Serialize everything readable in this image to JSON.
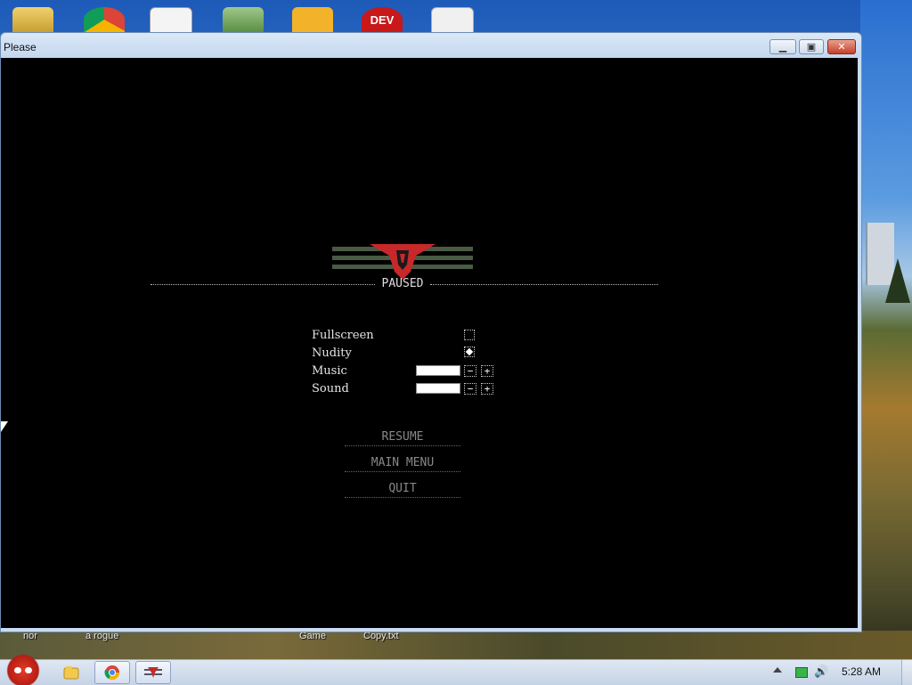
{
  "window": {
    "title": "Please",
    "minimize_icon": "minimize-icon",
    "maximize_icon": "maximize-icon",
    "close_icon": "close-icon"
  },
  "game": {
    "header": "PAUSED",
    "options": [
      {
        "label": "Fullscreen",
        "control": "checkbox",
        "checked": false
      },
      {
        "label": "Nudity",
        "control": "checkbox",
        "checked": true
      },
      {
        "label": "Music",
        "control": "slider",
        "value": 1.0
      },
      {
        "label": "Sound",
        "control": "slider",
        "value": 1.0
      }
    ],
    "stepper_minus": "−",
    "stepper_plus": "+",
    "menu": {
      "resume": "RESUME",
      "main_menu": "MAIN MENU",
      "quit": "QUIT"
    },
    "colors": {
      "emblem_red": "#c8282a",
      "emblem_stripes": "#4a5a44",
      "background": "#000000"
    }
  },
  "desktop": {
    "icons": [
      "folder-icon",
      "chrome-icon",
      "solitaire-icon",
      "shield-icon",
      "bad-piggies-icon",
      "dev-icon",
      "notepad-icon"
    ],
    "dev_label": "DEV",
    "bottom_labels": [
      "nor",
      "a rogue",
      "Game",
      "Copy.txt"
    ]
  },
  "taskbar": {
    "items": [
      "explorer-icon",
      "chrome-icon",
      "papers-please-icon"
    ],
    "tray_icons": [
      "show-hidden-icons",
      "network-icon",
      "volume-icon"
    ],
    "clock": "5:28 AM"
  }
}
